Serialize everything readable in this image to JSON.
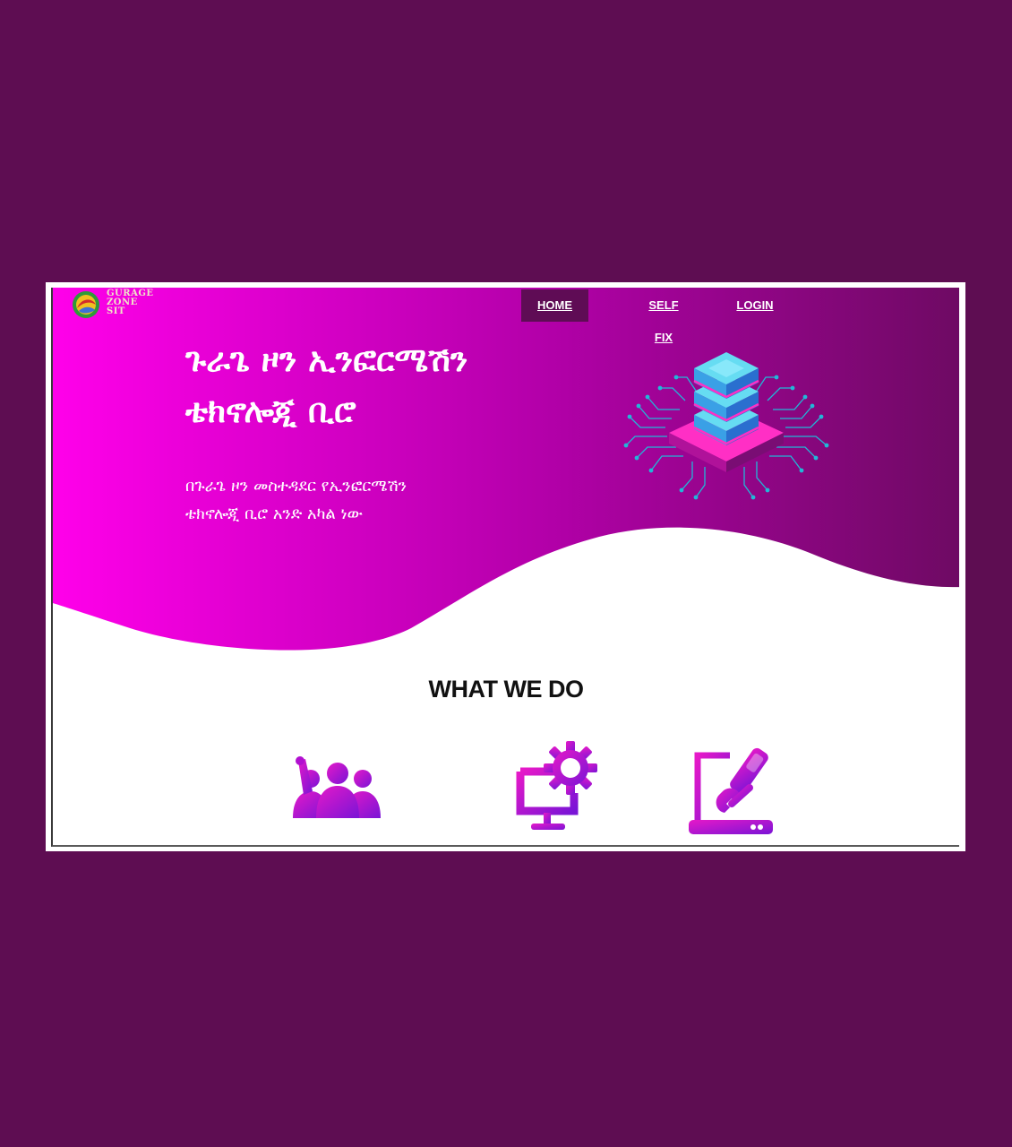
{
  "brand": {
    "logo_lines": [
      "GURAGE",
      "ZONE",
      "SIT"
    ]
  },
  "nav": {
    "items": [
      {
        "label": "HOME",
        "active": true
      },
      {
        "label": "SELF FIX",
        "active": false
      },
      {
        "label": "LOGIN",
        "active": false
      }
    ]
  },
  "hero": {
    "title_line1": "ጉራጌ ዞን ኢንፎርሜሽን",
    "title_line2": "ቴክኖሎጂ ቢሮ",
    "subtitle_line1": "በጉራጌ ዞን መስተዳደር የኢንፎርሜሽን",
    "subtitle_line2": "ቴክኖሎጂ ቢሮ አንድ አካል ነው",
    "illustration": "server-stack-circuit-illustration"
  },
  "services": {
    "title": "WHAT WE DO",
    "icons": [
      "team-icon",
      "computer-settings-icon",
      "laptop-repair-icon"
    ]
  },
  "colors": {
    "outer_background": "#5e0d52",
    "hero_gradient_start": "#ff00ea",
    "hero_gradient_end": "#6e0a63",
    "nav_active": "#5f0c55",
    "icon_gradient_start": "#e619c8",
    "icon_gradient_end": "#7a14d6"
  }
}
